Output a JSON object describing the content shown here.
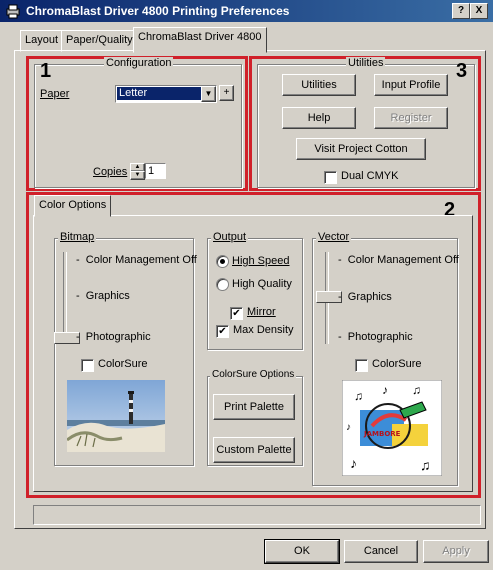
{
  "window": {
    "title": "ChromaBlast Driver 4800 Printing Preferences",
    "help_btn": "?",
    "close_btn": "X"
  },
  "tabs": [
    {
      "label": "Layout"
    },
    {
      "label": "Paper/Quality"
    },
    {
      "label": "ChromaBlast Driver 4800"
    }
  ],
  "callouts": [
    "1",
    "2",
    "3"
  ],
  "configuration": {
    "title": "Configuration",
    "paper_label": "Paper",
    "paper_value": "Letter",
    "add_btn": "+",
    "copies_label": "Copies",
    "copies_value": "1"
  },
  "utilities": {
    "title": "Utilities",
    "utilities_btn": "Utilities",
    "input_profile_btn": "Input Profile",
    "help_btn": "Help",
    "register_btn": "Register",
    "visit_btn": "Visit Project Cotton",
    "dual_cmyk_label": "Dual CMYK",
    "dual_cmyk_checked": false
  },
  "color_options": {
    "tab_label": "Color Options",
    "bitmap": {
      "title": "Bitmap",
      "levels": [
        "Color Management Off",
        "Graphics",
        "Photographic"
      ],
      "selected": "Photographic",
      "colorsure_label": "ColorSure",
      "colorsure_checked": false
    },
    "output": {
      "title": "Output",
      "high_speed": "High Speed",
      "high_quality": "High Quality",
      "selected": "High Speed",
      "mirror_label": "Mirror",
      "mirror_checked": true,
      "max_density_label": "Max Density",
      "max_density_checked": true
    },
    "colorsure_options": {
      "title": "ColorSure Options",
      "print_palette_btn": "Print Palette",
      "custom_palette_btn": "Custom Palette"
    },
    "vector": {
      "title": "Vector",
      "levels": [
        "Color Management Off",
        "Graphics",
        "Photographic"
      ],
      "selected": "Graphics",
      "colorsure_label": "ColorSure",
      "colorsure_checked": false
    }
  },
  "footer": {
    "ok_btn": "OK",
    "cancel_btn": "Cancel",
    "apply_btn": "Apply"
  },
  "colors": {
    "dialog_bg": "#d4d0c8",
    "title_bar": "#0a246a",
    "callout_border": "#d0202a",
    "selection": "#0a246a"
  }
}
